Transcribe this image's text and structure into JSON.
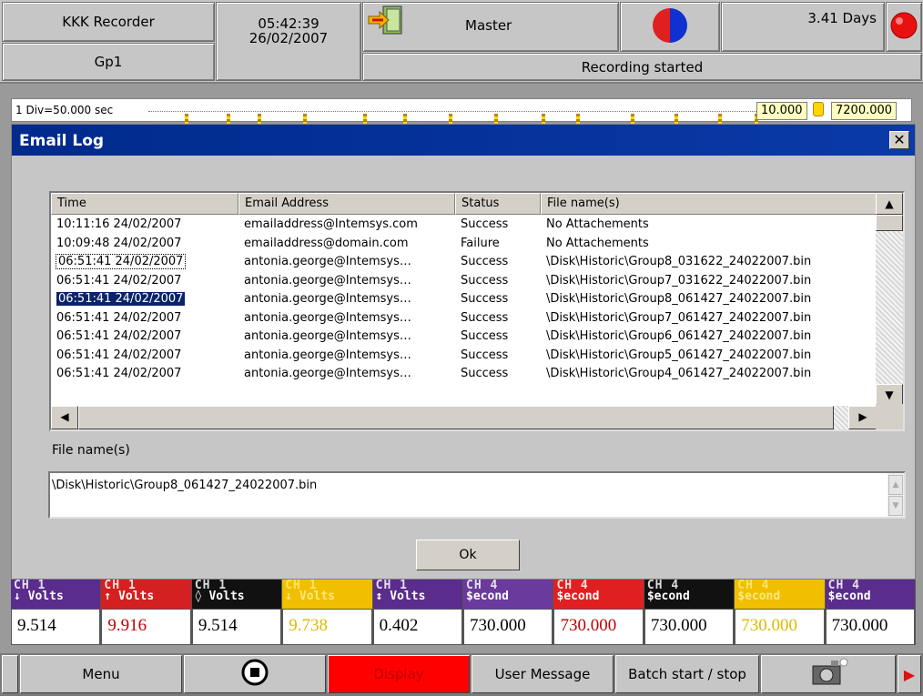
{
  "header": {
    "app_name": "KKK Recorder",
    "group": "Gp1",
    "time": "05:42:39",
    "date": "26/02/2007",
    "mode": "Master",
    "status": "Recording started",
    "remaining": "3.41 Days",
    "icons": {
      "door": "exit-door-icon",
      "disk": "status-disk-icon",
      "alarm": "alarm-indicator-icon"
    }
  },
  "timeline": {
    "division": "1 Div=50.000 sec",
    "value_low": "10.000",
    "value_high": "7200.000"
  },
  "dialog": {
    "title": "Email Log",
    "columns": [
      "Time",
      "Email Address",
      "Status",
      "File name(s)"
    ],
    "rows": [
      {
        "time": "10:11:16 24/02/2007",
        "email": "emailaddress@Intemsys.com",
        "status": "Success",
        "file": "No Attachements"
      },
      {
        "time": "10:09:48 24/02/2007",
        "email": "emailaddress@domain.com",
        "status": "Failure",
        "file": "No Attachements"
      },
      {
        "time": "06:51:41 24/02/2007",
        "email": "antonia.george@Intemsys…",
        "status": "Success",
        "file": "\\Disk\\Historic\\Group8_031622_24022007.bin"
      },
      {
        "time": "06:51:41 24/02/2007",
        "email": "antonia.george@Intemsys…",
        "status": "Success",
        "file": "\\Disk\\Historic\\Group7_031622_24022007.bin"
      },
      {
        "time": "06:51:41 24/02/2007",
        "email": "antonia.george@Intemsys…",
        "status": "Success",
        "file": "\\Disk\\Historic\\Group8_061427_24022007.bin"
      },
      {
        "time": "06:51:41 24/02/2007",
        "email": "antonia.george@Intemsys…",
        "status": "Success",
        "file": "\\Disk\\Historic\\Group7_061427_24022007.bin"
      },
      {
        "time": "06:51:41 24/02/2007",
        "email": "antonia.george@Intemsys…",
        "status": "Success",
        "file": "\\Disk\\Historic\\Group6_061427_24022007.bin"
      },
      {
        "time": "06:51:41 24/02/2007",
        "email": "antonia.george@Intemsys…",
        "status": "Success",
        "file": "\\Disk\\Historic\\Group5_061427_24022007.bin"
      },
      {
        "time": "06:51:41 24/02/2007",
        "email": "antonia.george@Intemsys…",
        "status": "Success",
        "file": "\\Disk\\Historic\\Group4_061427_24022007.bin"
      }
    ],
    "selected_row": 4,
    "focused_row": 2,
    "file_label": "File name(s)",
    "file_value": "\\Disk\\Historic\\Group8_061427_24022007.bin",
    "ok_label": "Ok"
  },
  "channels": [
    {
      "head": "CH 1",
      "unit": "↓ Volts",
      "value": "9.514",
      "head_bg": "#5a2d8c",
      "head_fg": "#ffffff",
      "value_color": "#000000"
    },
    {
      "head": "CH 1",
      "unit": "↑ Volts",
      "value": "9.916",
      "head_bg": "#d42020",
      "head_fg": "#ffffff",
      "value_color": "#c00000"
    },
    {
      "head": "CH 1",
      "unit": "◊ Volts",
      "value": "9.514",
      "head_bg": "#111111",
      "head_fg": "#ffffff",
      "value_color": "#000000"
    },
    {
      "head": "CH 1",
      "unit": "↓ Volts",
      "value": "9.738",
      "head_bg": "#f0c000",
      "head_fg": "#ffe680",
      "value_color": "#e0b800"
    },
    {
      "head": "CH 1",
      "unit": "↕ Volts",
      "value": "0.402",
      "head_bg": "#5a2d8c",
      "head_fg": "#ffffff",
      "value_color": "#000000"
    },
    {
      "head": "CH 4",
      "unit": "$econd",
      "value": "730.000",
      "head_bg": "#6a3a9c",
      "head_fg": "#ffffff",
      "value_color": "#000000"
    },
    {
      "head": "CH 4",
      "unit": "$econd",
      "value": "730.000",
      "head_bg": "#e02020",
      "head_fg": "#ffffff",
      "value_color": "#c00000"
    },
    {
      "head": "CH 4",
      "unit": "$econd",
      "value": "730.000",
      "head_bg": "#111111",
      "head_fg": "#ffffff",
      "value_color": "#000000"
    },
    {
      "head": "CH 4",
      "unit": "$econd",
      "value": "730.000",
      "head_bg": "#f0c000",
      "head_fg": "#ffe680",
      "value_color": "#e0b800"
    },
    {
      "head": "CH 4",
      "unit": "$econd",
      "value": "730.000",
      "head_bg": "#5a2d8c",
      "head_fg": "#ffffff",
      "value_color": "#000000"
    }
  ],
  "bottom_bar": {
    "menu": "Menu",
    "display": "Display",
    "user_message": "User Message",
    "batch": "Batch start / stop",
    "icons": {
      "stop": "stop-icon",
      "camera": "camera-icon",
      "more": "more-arrow-icon"
    }
  },
  "colors": {
    "title_bar": "#0a246a",
    "display_button": "#ff0000",
    "accent_yellow": "#ffd700"
  }
}
